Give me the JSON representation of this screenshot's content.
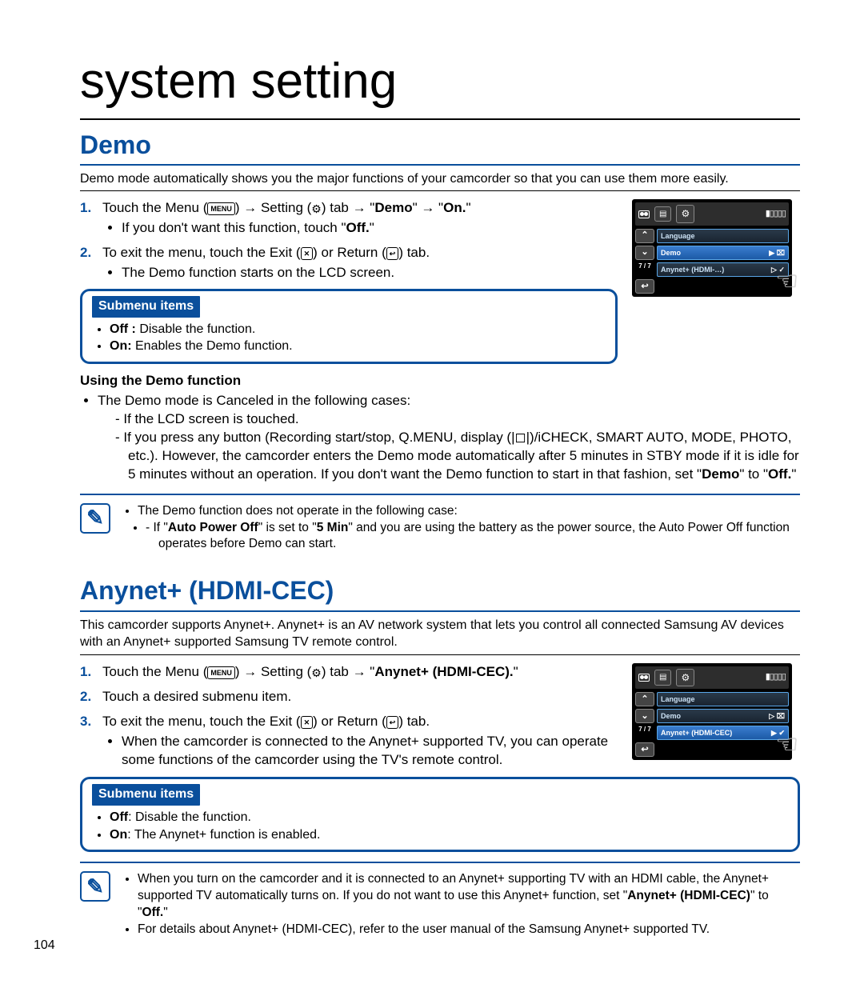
{
  "page": {
    "title": "system setting",
    "number": "104"
  },
  "demo": {
    "heading": "Demo",
    "intro": "Demo mode automatically shows you the major functions of your camcorder so that you can use them more easily.",
    "step1_a": "Touch the Menu (",
    "step1_b": ") → Setting (",
    "step1_c": ") tab → \"",
    "step1_demo": "Demo",
    "step1_d": "\" → \"",
    "step1_on": "On.",
    "step1_e": "\"",
    "step1_sub": "If you don't want this function, touch \"",
    "step1_sub_off": "Off.",
    "step1_sub_end": "\"",
    "step2_a": "To exit the menu, touch the Exit (",
    "step2_b": ") or Return (",
    "step2_c": ") tab.",
    "step2_sub": "The Demo function starts on the LCD screen.",
    "submenu_label": "Submenu items",
    "sub_off_b": "Off :",
    "sub_off_t": " Disable the function.",
    "sub_on_b": "On:",
    "sub_on_t": " Enables the Demo function.",
    "using_head": "Using the Demo function",
    "using_lead": "The Demo mode is Canceled in the following cases:",
    "using_d1": "If the LCD screen is touched.",
    "using_d2": "If you press any button (Recording start/stop, Q.MENU, display (|◻|)/iCHECK, SMART AUTO, MODE, PHOTO, etc.). However, the camcorder enters the Demo mode automatically after 5 minutes in STBY mode if it is idle for 5 minutes without an operation. If you don't want the Demo function to start in that fashion, set \"",
    "using_d2_demo": "Demo",
    "using_d2_mid": "\" to \"",
    "using_d2_off": "Off.",
    "using_d2_end": "\"",
    "note_lead": "The Demo function does not operate in the following case:",
    "note_d1_a": "If \"",
    "note_d1_apo": "Auto Power Off",
    "note_d1_b": "\" is set to \"",
    "note_d1_5": "5 Min",
    "note_d1_c": "\" and you are using the battery as the power source, the Auto Power Off function operates before Demo can start."
  },
  "anynet": {
    "heading": "Anynet+ (HDMI-CEC)",
    "intro": "This camcorder supports Anynet+. Anynet+ is an AV network system that lets you control all connected Samsung AV devices with an Anynet+ supported Samsung TV remote control.",
    "step1_a": "Touch the Menu (",
    "step1_b": ") → Setting (",
    "step1_c": ") tab → \"",
    "step1_name": "Anynet+ (HDMI-CEC).",
    "step1_d": "\"",
    "step2": "Touch a desired submenu item.",
    "step3_a": "To exit the menu, touch the Exit (",
    "step3_b": ") or Return (",
    "step3_c": ") tab.",
    "step3_sub": "When the camcorder is connected to the Anynet+ supported TV, you can operate some functions of the camcorder using the TV's remote control.",
    "submenu_label": "Submenu items",
    "sub_off_b": "Off",
    "sub_off_t": ": Disable the function.",
    "sub_on_b": "On",
    "sub_on_t": ": The Anynet+ function is enabled.",
    "note1_a": "When you turn on the camcorder and it is connected to an Anynet+ supporting TV with an HDMI cable, the Anynet+ supported TV automatically turns on. If you do not want to use this Anynet+ function, set \"",
    "note1_name": "Anynet+ (HDMI-CEC)",
    "note1_b": "\" to \"",
    "note1_off": "Off.",
    "note1_c": "\"",
    "note2": "For details about Anynet+ (HDMI-CEC), refer to the user manual of the Samsung Anynet+ supported TV."
  },
  "lcd": {
    "page": "7 / 7",
    "row_language": "Language",
    "row_demo": "Demo",
    "row_anynet": "Anynet+ (HDMI-CEC)",
    "row_anynet_trunc": "Anynet+ (HDMI-…)",
    "play": "▶",
    "check": "✔"
  },
  "icons": {
    "menu": "MENU",
    "x": "✕",
    "return": "↩"
  }
}
